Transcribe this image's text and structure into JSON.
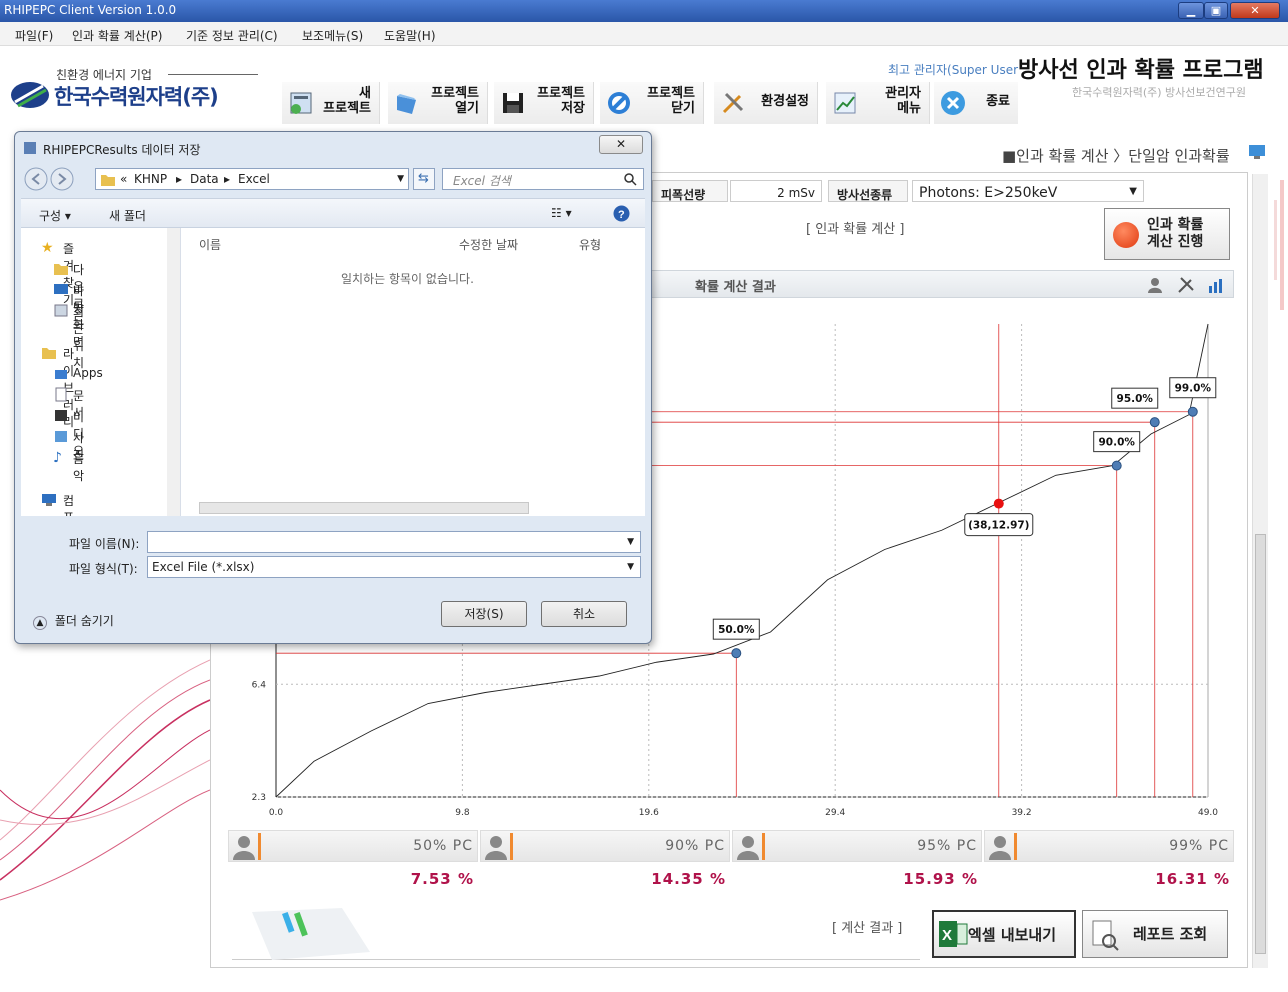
{
  "window": {
    "title": "RHIPEPC Client Version 1.0.0",
    "btn_min": "▁",
    "btn_max": "▣",
    "btn_close": "✕"
  },
  "menu": [
    "파일(F)",
    "인과 확률 계산(P)",
    "기준 정보 관리(C)",
    "보조메뉴(S)",
    "도움말(H)"
  ],
  "logo": {
    "tagline": "친환경 에너지 기업",
    "name": "한국수력원자력(주)"
  },
  "toolbar": [
    {
      "label": "새\n프로젝트"
    },
    {
      "label": "프로젝트\n열기"
    },
    {
      "label": "프로젝트\n저장"
    },
    {
      "label": "프로젝트\n닫기"
    },
    {
      "label": "환경설정"
    },
    {
      "label": "관리자\n메뉴"
    },
    {
      "label": "종료"
    }
  ],
  "header": {
    "user": "최고 관리자(Super User",
    "title": "방사선 인과 확률 프로그램",
    "subtitle": "한국수력원자력(주) 방사선보건연구원",
    "breadcrumb": "■인과 확률 계산 〉단일암 인과확률"
  },
  "params": {
    "dose_label": "피폭선량",
    "dose_value": "2 mSv",
    "rad_label": "방사선종류",
    "rad_value": "Photons: E>250keV"
  },
  "calc": {
    "caption": "[ 인과 확률 계산 ]",
    "run_label": "인과 확률\n계산 진행",
    "result_header": "확률 계산 결과"
  },
  "chart_data": {
    "type": "line",
    "x": [
      0,
      2,
      5,
      8,
      11,
      14,
      17,
      20,
      23,
      26,
      29,
      32,
      35,
      38,
      41,
      44,
      46,
      48,
      49
    ],
    "y": [
      2.3,
      3.6,
      4.7,
      5.7,
      6.1,
      6.4,
      6.7,
      7.2,
      7.5,
      8.3,
      10.2,
      11.3,
      12.0,
      13.0,
      14.0,
      14.35,
      15.5,
      16.2,
      19.5
    ],
    "xticks": [
      "0.0",
      "9.8",
      "19.6",
      "29.4",
      "39.2",
      "49.0"
    ],
    "yticks": [
      "2.3",
      "6.4"
    ],
    "xlim": [
      0,
      49
    ],
    "ylim": [
      2.3,
      19.5
    ],
    "grid": true,
    "markers": [
      {
        "label": "50.0%",
        "x": 24.2,
        "y": 7.53
      },
      {
        "label": "90.0%",
        "x": 44.2,
        "y": 14.35
      },
      {
        "label": "95.0%",
        "x": 46.2,
        "y": 15.93
      },
      {
        "label": "99.0%",
        "x": 48.2,
        "y": 16.31
      }
    ],
    "point": {
      "label": "(38,12.97)",
      "x": 38,
      "y": 12.97
    }
  },
  "pc": [
    {
      "label": "50% PC",
      "value": "7.53 %"
    },
    {
      "label": "90% PC",
      "value": "14.35 %"
    },
    {
      "label": "95% PC",
      "value": "15.93 %"
    },
    {
      "label": "99% PC",
      "value": "16.31 %"
    }
  ],
  "footer": {
    "caption": "[ 계산 결과 ]",
    "excel": "엑셀 내보내기",
    "report": "레포트 조회"
  },
  "dialog": {
    "title": "RHIPEPCResults 데이터 저장",
    "close": "✕",
    "path": [
      "«",
      "KHNP",
      "▸",
      "Data",
      "▸",
      "Excel"
    ],
    "search_placeholder": "Excel 검색",
    "organize": "구성 ▾",
    "new_folder": "새 폴더",
    "nav": [
      "즐겨찾기",
      "다운로드",
      "바탕 화면",
      "최근 위치",
      "라이브러리",
      "Apps",
      "문서",
      "비디오",
      "사진",
      "음악",
      "컴퓨터"
    ],
    "columns": [
      "이름",
      "수정한 날짜",
      "유형"
    ],
    "empty": "일치하는 항목이 없습니다.",
    "filename_label": "파일 이름(N):",
    "filetype_label": "파일 형식(T):",
    "filetype_value": "Excel File (*.xlsx)",
    "save": "저장(S)",
    "cancel": "취소",
    "hide_folders": "폴더 숨기기"
  }
}
